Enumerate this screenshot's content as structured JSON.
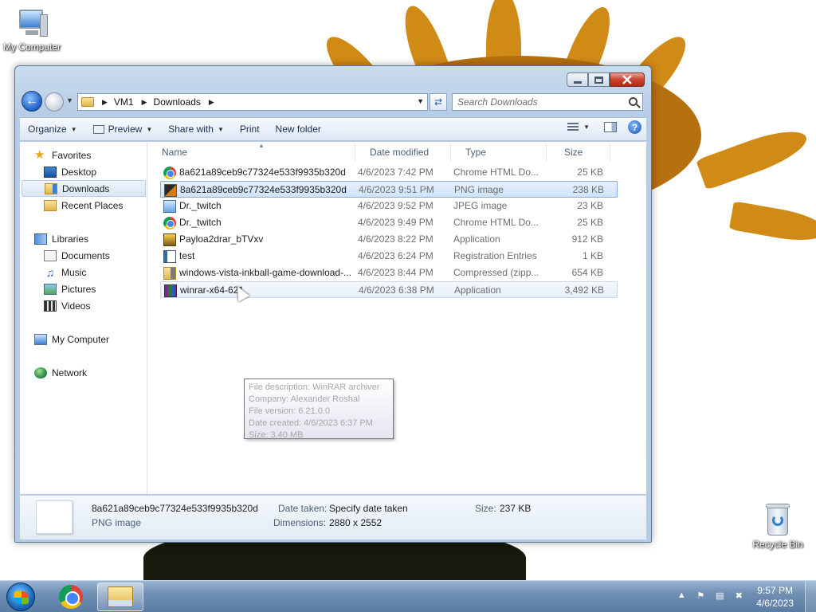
{
  "desktop": {
    "icons": [
      {
        "label": "My Computer",
        "icon": "computer-icon"
      },
      {
        "label": "Recycle Bin",
        "icon": "recycle-bin-icon"
      }
    ]
  },
  "window": {
    "nav": {
      "breadcrumb": [
        "VM1",
        "Downloads"
      ],
      "search_placeholder": "Search Downloads"
    },
    "toolbar": {
      "organize": "Organize",
      "preview": "Preview",
      "share_with": "Share with",
      "print": "Print",
      "new_folder": "New folder"
    },
    "navpane": {
      "favorites": "Favorites",
      "desktop": "Desktop",
      "downloads": "Downloads",
      "recent_places": "Recent Places",
      "libraries": "Libraries",
      "documents": "Documents",
      "music": "Music",
      "pictures": "Pictures",
      "videos": "Videos",
      "my_computer": "My Computer",
      "network": "Network"
    },
    "columns": {
      "name": "Name",
      "date_modified": "Date modified",
      "type": "Type",
      "size": "Size"
    },
    "files": [
      {
        "name": "8a621a89ceb9c77324e533f9935b320d",
        "date": "4/6/2023 7:42 PM",
        "type": "Chrome HTML Do...",
        "size": "25 KB",
        "icon": "chrome-icon"
      },
      {
        "name": "8a621a89ceb9c77324e533f9935b320d",
        "date": "4/6/2023 9:51 PM",
        "type": "PNG image",
        "size": "238 KB",
        "icon": "png-file-icon"
      },
      {
        "name": "Dr._twitch",
        "date": "4/6/2023 9:52 PM",
        "type": "JPEG image",
        "size": "23 KB",
        "icon": "jpeg-file-icon"
      },
      {
        "name": "Dr._twitch",
        "date": "4/6/2023 9:49 PM",
        "type": "Chrome HTML Do...",
        "size": "25 KB",
        "icon": "chrome-icon"
      },
      {
        "name": "Payloa2drar_bTVxv",
        "date": "4/6/2023 8:22 PM",
        "type": "Application",
        "size": "912 KB",
        "icon": "application-icon"
      },
      {
        "name": "test",
        "date": "4/6/2023 6:24 PM",
        "type": "Registration Entries",
        "size": "1 KB",
        "icon": "registry-file-icon"
      },
      {
        "name": "windows-vista-inkball-game-download-...",
        "date": "4/6/2023 8:44 PM",
        "type": "Compressed (zipp...",
        "size": "654 KB",
        "icon": "zip-folder-icon"
      },
      {
        "name": "winrar-x64-621",
        "date": "4/6/2023 6:38 PM",
        "type": "Application",
        "size": "3,492 KB",
        "icon": "winrar-icon"
      }
    ],
    "tooltip": {
      "line1": "File description: WinRAR archiver",
      "line2": "Company: Alexander Roshal",
      "line3": "File version: 6.21.0.0",
      "line4": "Date created: 4/6/2023 6:37 PM",
      "line5": "Size: 3.40 MB"
    },
    "details": {
      "filename": "8a621a89ceb9c77324e533f9935b320d",
      "filetype": "PNG image",
      "date_taken_label": "Date taken:",
      "date_taken_value": "Specify date taken",
      "dimensions_label": "Dimensions:",
      "dimensions_value": "2880 x 2552",
      "size_label": "Size:",
      "size_value": "237 KB"
    }
  },
  "taskbar": {
    "clock_time": "9:57 PM",
    "clock_date": "4/6/2023"
  }
}
